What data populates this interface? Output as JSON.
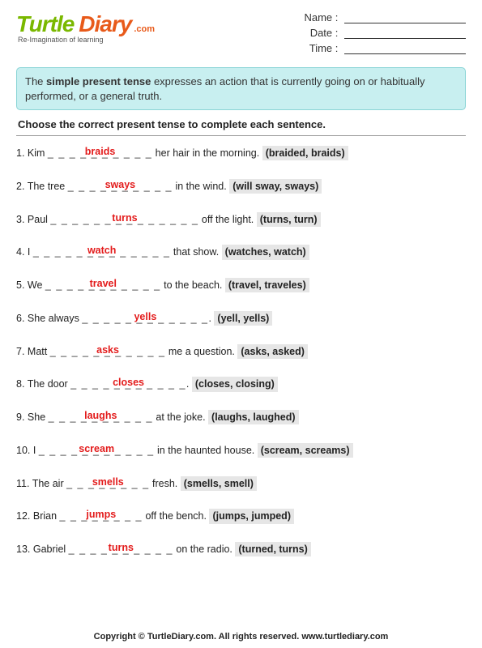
{
  "logo": {
    "turtle": "Turtle",
    "diary": "Diary",
    "dotcom": ".com",
    "tagline": "Re-Imagination of learning"
  },
  "meta": {
    "name_label": "Name :",
    "date_label": "Date :",
    "time_label": "Time :"
  },
  "info_box": {
    "prefix": "The ",
    "bold": "simple present tense",
    "suffix": " expresses an action that is currently going on or habitually performed, or a general truth."
  },
  "instruction": "Choose the correct present tense to complete each sentence.",
  "questions": [
    {
      "num": "1.",
      "pre": "Kim ",
      "dashes": "_ _ _ _ _ _ _ _ _ _",
      "answer": "braids",
      "post": " her hair in the morning.  ",
      "options": "(braided, braids)"
    },
    {
      "num": "2.",
      "pre": "The tree ",
      "dashes": "_ _ _ _ _ _ _ _ _ _",
      "answer": "sways",
      "post": " in the wind.  ",
      "options": "(will sway, sways)"
    },
    {
      "num": "3.",
      "pre": "Paul ",
      "dashes": "_ _ _ _ _ _ _ _ _ _ _ _ _ _",
      "answer": "turns",
      "post": " off the light.  ",
      "options": "(turns, turn)"
    },
    {
      "num": "4.",
      "pre": "I ",
      "dashes": "_ _ _ _ _ _ _ _ _ _ _ _ _",
      "answer": "watch",
      "post": " that show.  ",
      "options": "(watches, watch)"
    },
    {
      "num": "5.",
      "pre": "We ",
      "dashes": "_ _ _ _ _ _ _ _ _ _ _",
      "answer": "travel",
      "post": " to the beach.  ",
      "options": "(travel, traveles)"
    },
    {
      "num": "6.",
      "pre": "She always ",
      "dashes": "_ _ _ _ _ _ _ _ _ _ _ _",
      "answer": "yells",
      "post": ".  ",
      "options": "(yell, yells)"
    },
    {
      "num": "7.",
      "pre": "Matt ",
      "dashes": "_ _ _ _ _ _ _ _ _ _ _",
      "answer": "asks",
      "post": " me a question.  ",
      "options": "(asks, asked)"
    },
    {
      "num": "8.",
      "pre": "The door ",
      "dashes": "_ _ _ _ _ _ _ _ _ _ _",
      "answer": "closes",
      "post": ".  ",
      "options": "(closes, closing)"
    },
    {
      "num": "9.",
      "pre": "She ",
      "dashes": "_ _ _ _ _ _ _ _ _ _",
      "answer": "laughs",
      "post": " at the joke.  ",
      "options": "(laughs, laughed)"
    },
    {
      "num": "10.",
      "pre": "I ",
      "dashes": "_ _ _ _ _ _ _ _ _ _ _",
      "answer": "scream",
      "post": " in the haunted house.  ",
      "options": "(scream, screams)"
    },
    {
      "num": "11.",
      "pre": "The air ",
      "dashes": "_ _ _ _ _ _ _ _",
      "answer": "smells",
      "post": " fresh.  ",
      "options": "(smells, smell)"
    },
    {
      "num": "12.",
      "pre": "Brian ",
      "dashes": "_ _ _ _ _ _ _ _",
      "answer": "jumps",
      "post": " off the bench.  ",
      "options": "(jumps, jumped)"
    },
    {
      "num": "13.",
      "pre": "Gabriel ",
      "dashes": "_ _ _ _ _ _ _ _ _ _",
      "answer": "turns",
      "post": " on the radio.  ",
      "options": "(turned, turns)"
    }
  ],
  "footer": "Copyright © TurtleDiary.com. All rights reserved. www.turtlediary.com"
}
